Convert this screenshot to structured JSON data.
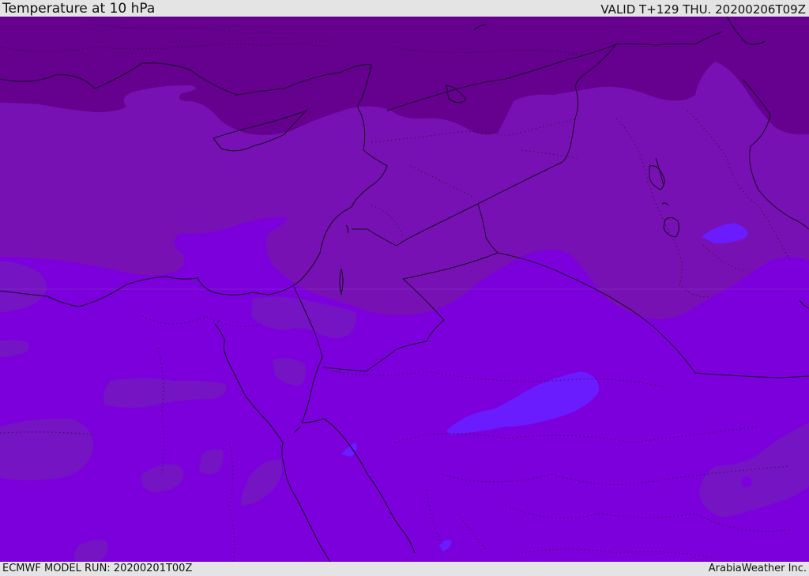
{
  "header": {
    "title": "Temperature at 10 hPa",
    "valid": "VALID T+129 THU. 20200206T09Z"
  },
  "footer": {
    "model_run": "ECMWF MODEL RUN: 20200201T00Z",
    "credit": "ArabiaWeather Inc."
  },
  "colors": {
    "deep_purple": "#65008f",
    "purple": "#7811b3",
    "violet": "#7c00db",
    "bright_violet": "#6a1cff",
    "muted_violet": "#7414c3",
    "border_line": "#1a0a2a"
  }
}
